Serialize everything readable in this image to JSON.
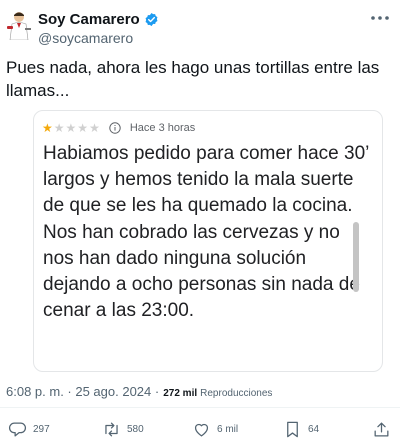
{
  "user": {
    "name": "Soy Camarero",
    "handle": "@soycamarero"
  },
  "tweet": {
    "text": "Pues nada, ahora les hago unas tortillas entre las llamas..."
  },
  "review": {
    "rating": 1,
    "max_rating": 5,
    "time_ago": "Hace 3 horas",
    "text": "Habiamos pedido para comer hace 30’ largos y hemos tenido la mala suerte de que se les ha quemado la cocina. Nos han cobrado las cervezas y no nos han dado ninguna solución dejando a ocho personas sin nada de cenar a las 23:00."
  },
  "meta": {
    "datetime": "6:08 p. m. · 25 ago. 2024 ·",
    "views": "272 mil",
    "views_label": "Reproducciones"
  },
  "actions": {
    "replies": "297",
    "reposts": "580",
    "likes": "6 mil",
    "bookmarks": "64"
  },
  "colors": {
    "text": "#0f1419",
    "secondary": "#536471",
    "verified": "#1d9bf0",
    "star": "#f4a90b"
  }
}
